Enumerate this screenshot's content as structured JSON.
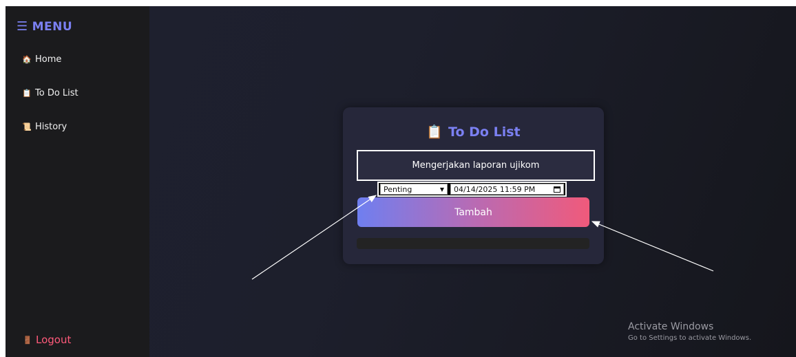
{
  "sidebar": {
    "menu_icon": "☰",
    "menu_label": "MENU",
    "items": [
      {
        "icon": "🏠",
        "icon_name": "home-icon",
        "label": "Home"
      },
      {
        "icon": "📋",
        "icon_name": "clipboard-icon",
        "label": "To Do List"
      },
      {
        "icon": "📜",
        "icon_name": "scroll-icon",
        "label": "History"
      }
    ],
    "logout": {
      "icon": "🚪",
      "icon_name": "door-icon",
      "label": "Logout"
    }
  },
  "card": {
    "title_icon": "📋",
    "title": "To Do List",
    "task_value": "Mengerjakan laporan ujikom",
    "priority_selected": "Penting",
    "deadline_value": "04/14/2025 11:59 PM",
    "add_label": "Tambah"
  },
  "watermark": {
    "title": "Activate Windows",
    "subtitle": "Go to Settings to activate Windows."
  },
  "colors": {
    "accent": "#7b80f2",
    "logout": "#ff5a7a",
    "button_start": "#6f7ff0",
    "button_end": "#f05a7b"
  }
}
